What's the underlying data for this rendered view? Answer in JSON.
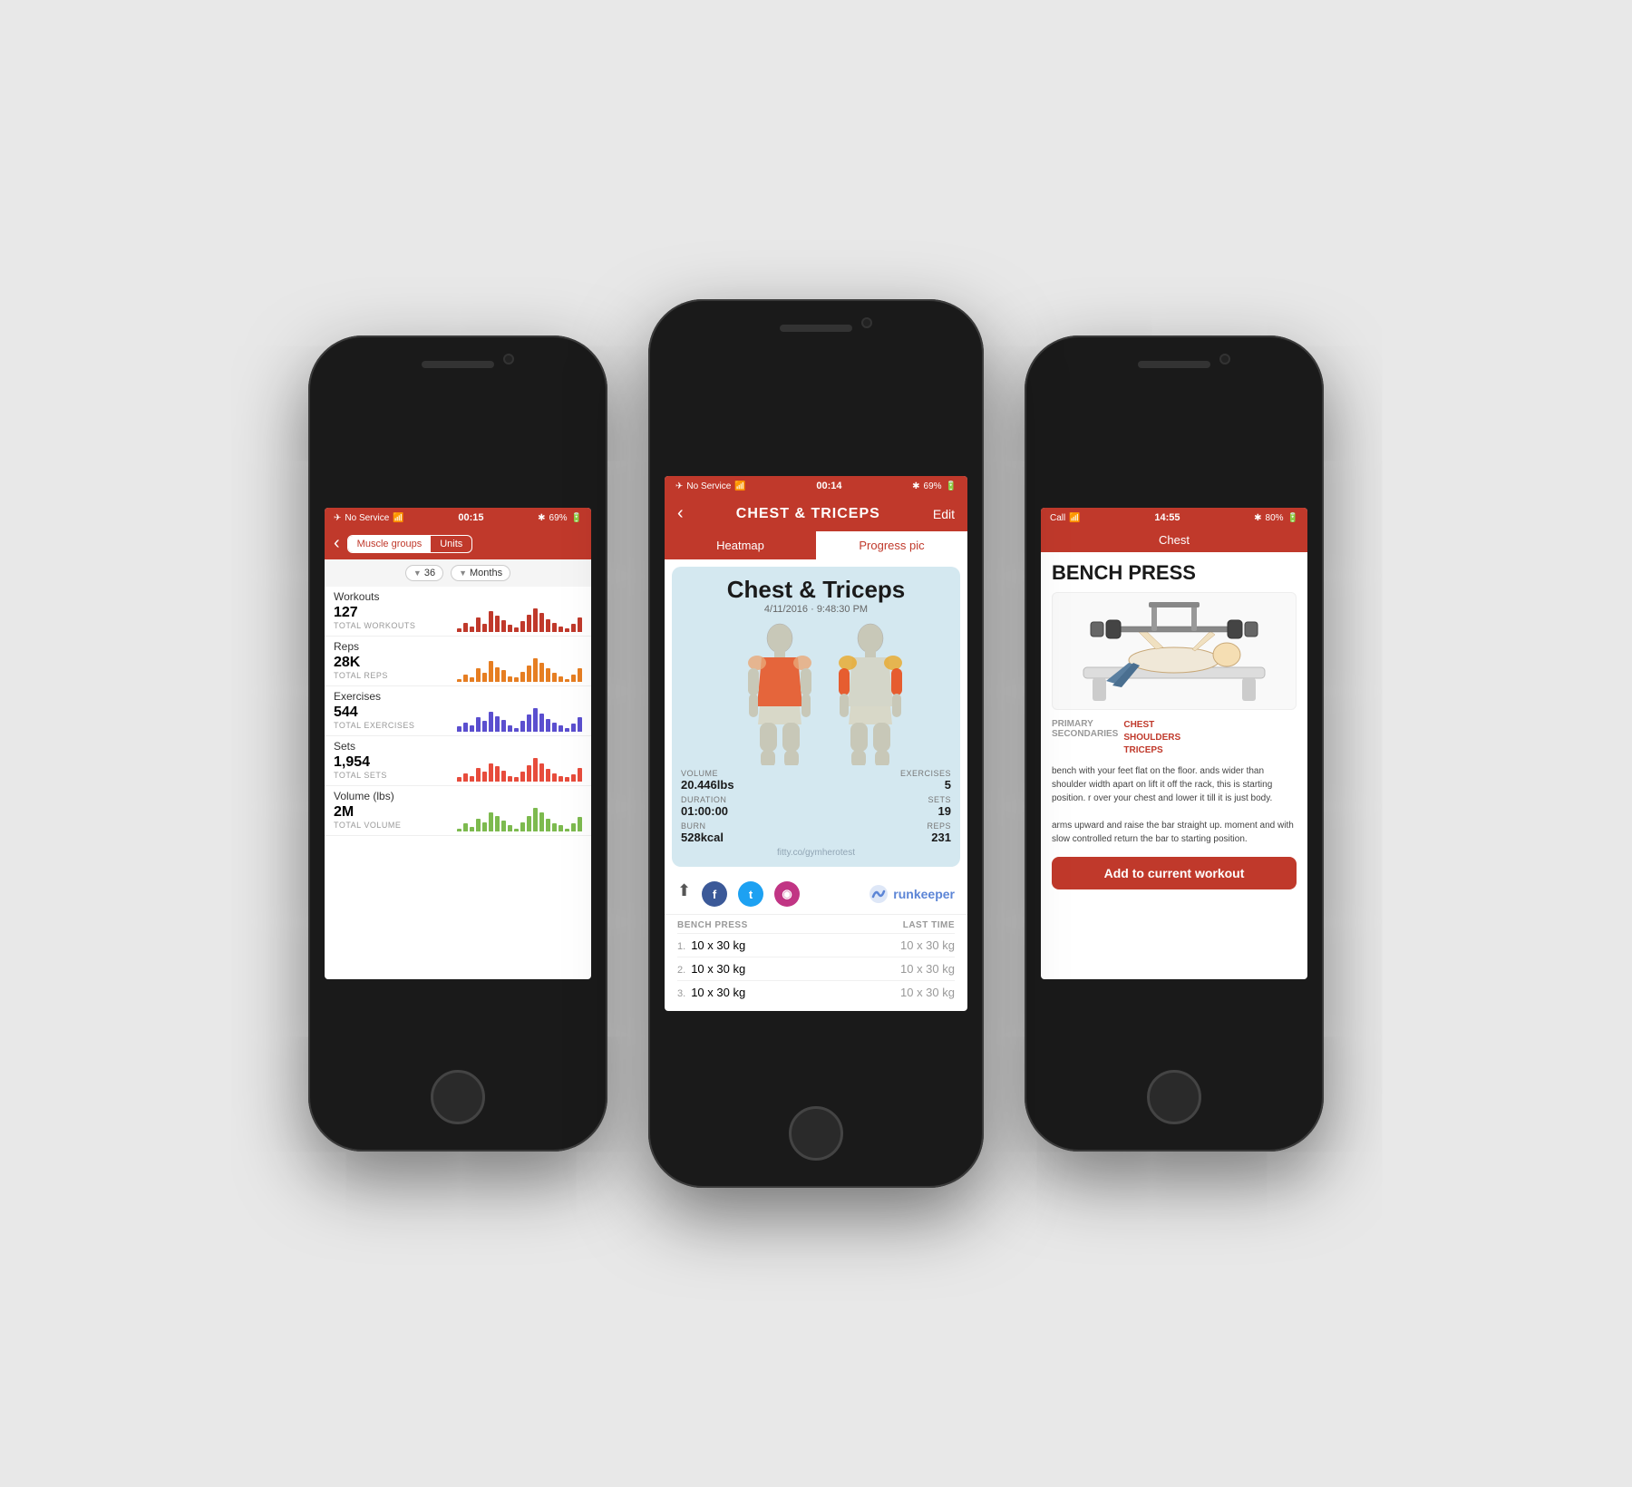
{
  "left_phone": {
    "status": {
      "service": "No Service",
      "wifi": "WiFi",
      "time": "00:15",
      "bt": "BT",
      "battery": "69%"
    },
    "nav": {
      "back": "‹",
      "seg_muscle": "Muscle groups",
      "seg_units": "Units"
    },
    "filter": {
      "count": "36",
      "period": "Months"
    },
    "stats": [
      {
        "label": "Workouts",
        "value": "127",
        "sub": "TOTAL WORKOUTS",
        "color": "#c0392b",
        "bars": [
          3,
          8,
          5,
          12,
          7,
          18,
          14,
          10,
          6,
          4,
          9,
          15,
          20,
          16,
          11,
          8,
          5,
          3,
          7,
          12
        ]
      },
      {
        "label": "Reps",
        "value": "28K",
        "sub": "TOTAL REPS",
        "color": "#e67e22",
        "bars": [
          2,
          5,
          3,
          9,
          6,
          14,
          10,
          8,
          4,
          3,
          7,
          11,
          16,
          13,
          9,
          6,
          4,
          2,
          5,
          9
        ]
      },
      {
        "label": "Exercises",
        "value": "544",
        "sub": "TOTAL EXERCISES",
        "color": "#5b4fcf",
        "bars": [
          4,
          7,
          5,
          11,
          8,
          15,
          12,
          9,
          5,
          3,
          8,
          13,
          18,
          14,
          10,
          7,
          5,
          3,
          6,
          11
        ]
      },
      {
        "label": "Sets",
        "value": "1,954",
        "sub": "TOTAL SETS",
        "color": "#e74c3c",
        "bars": [
          3,
          6,
          4,
          10,
          7,
          13,
          11,
          8,
          4,
          3,
          7,
          12,
          17,
          13,
          9,
          6,
          4,
          3,
          5,
          10
        ]
      },
      {
        "label": "Volume (lbs)",
        "value": "2M",
        "sub": "TOTAL VOLUME",
        "color": "#7dba4f",
        "bars": [
          2,
          5,
          3,
          8,
          6,
          12,
          10,
          7,
          4,
          2,
          6,
          10,
          15,
          12,
          8,
          5,
          4,
          2,
          5,
          9
        ]
      }
    ]
  },
  "center_phone": {
    "status": {
      "service": "No Service",
      "wifi": "WiFi",
      "time": "00:14",
      "bt": "BT",
      "battery": "69%"
    },
    "nav": {
      "back": "‹",
      "title": "CHEST & TRICEPS",
      "edit": "Edit"
    },
    "tabs": {
      "heatmap": "Heatmap",
      "progress_pic": "Progress pic"
    },
    "workout": {
      "title": "Chest & Triceps",
      "date": "4/11/2016 · 9:48:30 PM",
      "stats": {
        "volume_label": "VOLUME",
        "volume_value": "20.446lbs",
        "exercises_label": "EXERCISES",
        "exercises_value": "5",
        "duration_label": "DURATION",
        "duration_value": "01:00:00",
        "sets_label": "SETS",
        "sets_value": "19",
        "burn_label": "BURN",
        "burn_value": "528kcal",
        "reps_label": "REPS",
        "reps_value": "231"
      },
      "watermark": "fitty.co/gymherotest"
    },
    "share": {
      "upload": "⬆",
      "fb": "f",
      "tw": "t",
      "ig": "◉"
    },
    "runkeeper": "runkeeper",
    "exercise": {
      "name": "BENCH PRESS",
      "last_time_label": "LAST TIME",
      "sets": [
        {
          "num": "1.",
          "value": "10 x 30 kg",
          "last": "10 x 30 kg"
        },
        {
          "num": "2.",
          "value": "10 x 30 kg",
          "last": "10 x 30 kg"
        },
        {
          "num": "3.",
          "value": "10 x 30 kg",
          "last": "10 x 30 kg"
        }
      ]
    }
  },
  "right_phone": {
    "status": {
      "service": "Call",
      "wifi": "WiFi",
      "time": "14:55",
      "bt": "BT",
      "battery": "80%"
    },
    "header": "Chest",
    "title": "BENCH PRESS",
    "primary_label": "PRIMARY",
    "primary_value": "CHEST",
    "secondaries_label": "SECONDARIES",
    "secondaries_value": "SHOULDERS\nTRICEPS",
    "description": "bench with your feet flat on the floor. ands wider than shoulder width apart on lift it off the rack, this is starting position. r over your chest and lower it till it is just body.\n\narms upward and raise the bar straight up. moment and with slow controlled return the bar to starting position.",
    "add_button": "Add to current workout"
  }
}
